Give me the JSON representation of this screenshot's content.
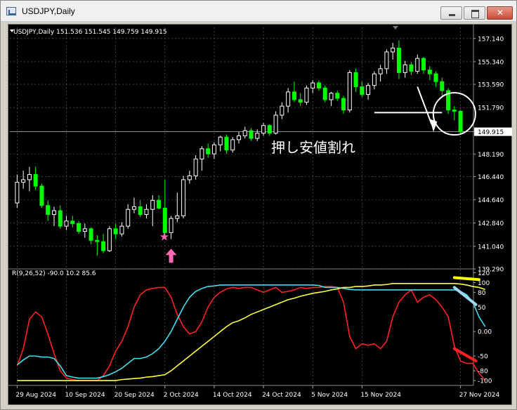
{
  "window": {
    "title": "USDJPY,Daily"
  },
  "chart_data": [
    {
      "type": "candlestick",
      "symbol_line": "USDJPY,Daily  151.536 151.545 149.759 149.915",
      "current_price_label": "149.915",
      "current_price": 149.915,
      "ylim": [
        139.29,
        158.0
      ],
      "price_ticks": [
        "157.140",
        "155.340",
        "153.590",
        "151.790",
        "149.915",
        "148.190",
        "146.440",
        "144.640",
        "142.840",
        "141.040",
        "139.290"
      ],
      "candles": [
        {
          "o": 144.4,
          "h": 146.6,
          "l": 144.0,
          "c": 146.0
        },
        {
          "o": 146.0,
          "h": 146.9,
          "l": 145.5,
          "c": 146.2
        },
        {
          "o": 146.2,
          "h": 147.2,
          "l": 145.3,
          "c": 146.6
        },
        {
          "o": 146.6,
          "h": 147.2,
          "l": 145.4,
          "c": 145.7
        },
        {
          "o": 145.7,
          "h": 145.9,
          "l": 144.0,
          "c": 144.2
        },
        {
          "o": 144.2,
          "h": 144.6,
          "l": 143.0,
          "c": 143.5
        },
        {
          "o": 143.5,
          "h": 144.1,
          "l": 142.6,
          "c": 143.8
        },
        {
          "o": 143.8,
          "h": 144.2,
          "l": 142.4,
          "c": 142.6
        },
        {
          "o": 142.6,
          "h": 143.4,
          "l": 142.3,
          "c": 143.0
        },
        {
          "o": 143.0,
          "h": 143.4,
          "l": 142.5,
          "c": 142.8
        },
        {
          "o": 142.8,
          "h": 143.0,
          "l": 142.0,
          "c": 142.2
        },
        {
          "o": 142.2,
          "h": 142.8,
          "l": 141.7,
          "c": 142.4
        },
        {
          "o": 142.4,
          "h": 142.5,
          "l": 141.2,
          "c": 141.5
        },
        {
          "o": 141.5,
          "h": 141.9,
          "l": 140.3,
          "c": 141.4
        },
        {
          "o": 141.4,
          "h": 142.0,
          "l": 140.5,
          "c": 140.7
        },
        {
          "o": 140.7,
          "h": 142.6,
          "l": 140.6,
          "c": 142.4
        },
        {
          "o": 142.4,
          "h": 142.8,
          "l": 141.6,
          "c": 142.0
        },
        {
          "o": 142.0,
          "h": 142.9,
          "l": 141.8,
          "c": 142.6
        },
        {
          "o": 142.6,
          "h": 144.3,
          "l": 142.4,
          "c": 143.9
        },
        {
          "o": 143.9,
          "h": 144.8,
          "l": 143.6,
          "c": 144.1
        },
        {
          "o": 144.1,
          "h": 144.6,
          "l": 143.3,
          "c": 143.5
        },
        {
          "o": 143.5,
          "h": 144.3,
          "l": 143.2,
          "c": 143.9
        },
        {
          "o": 143.9,
          "h": 145.0,
          "l": 142.6,
          "c": 144.6
        },
        {
          "o": 144.6,
          "h": 145.0,
          "l": 143.9,
          "c": 144.0
        },
        {
          "o": 144.0,
          "h": 146.2,
          "l": 141.8,
          "c": 142.1
        },
        {
          "o": 142.1,
          "h": 143.4,
          "l": 141.6,
          "c": 143.2
        },
        {
          "o": 143.2,
          "h": 145.2,
          "l": 142.9,
          "c": 143.4
        },
        {
          "o": 143.4,
          "h": 146.5,
          "l": 143.2,
          "c": 146.2
        },
        {
          "o": 146.2,
          "h": 146.9,
          "l": 145.9,
          "c": 146.5
        },
        {
          "o": 146.5,
          "h": 148.1,
          "l": 146.2,
          "c": 147.8
        },
        {
          "o": 147.8,
          "h": 148.8,
          "l": 146.9,
          "c": 148.6
        },
        {
          "o": 148.6,
          "h": 149.0,
          "l": 147.9,
          "c": 148.2
        },
        {
          "o": 148.2,
          "h": 149.1,
          "l": 147.8,
          "c": 148.9
        },
        {
          "o": 148.9,
          "h": 149.6,
          "l": 148.4,
          "c": 149.5
        },
        {
          "o": 149.5,
          "h": 149.7,
          "l": 148.2,
          "c": 148.5
        },
        {
          "o": 148.5,
          "h": 149.5,
          "l": 148.3,
          "c": 149.3
        },
        {
          "o": 149.3,
          "h": 149.9,
          "l": 149.0,
          "c": 149.6
        },
        {
          "o": 149.6,
          "h": 150.3,
          "l": 149.4,
          "c": 150.0
        },
        {
          "o": 150.0,
          "h": 150.2,
          "l": 149.2,
          "c": 149.4
        },
        {
          "o": 149.4,
          "h": 150.1,
          "l": 149.2,
          "c": 149.8
        },
        {
          "o": 149.8,
          "h": 150.6,
          "l": 149.6,
          "c": 150.4
        },
        {
          "o": 150.4,
          "h": 150.5,
          "l": 149.6,
          "c": 149.8
        },
        {
          "o": 149.8,
          "h": 151.5,
          "l": 149.7,
          "c": 151.2
        },
        {
          "o": 151.2,
          "h": 152.2,
          "l": 150.9,
          "c": 151.9
        },
        {
          "o": 151.9,
          "h": 153.3,
          "l": 151.4,
          "c": 153.0
        },
        {
          "o": 153.0,
          "h": 153.8,
          "l": 152.2,
          "c": 152.4
        },
        {
          "o": 152.4,
          "h": 152.9,
          "l": 151.9,
          "c": 152.2
        },
        {
          "o": 152.2,
          "h": 153.5,
          "l": 152.0,
          "c": 153.3
        },
        {
          "o": 153.3,
          "h": 153.9,
          "l": 152.9,
          "c": 153.7
        },
        {
          "o": 153.7,
          "h": 153.9,
          "l": 153.1,
          "c": 153.3
        },
        {
          "o": 153.3,
          "h": 153.5,
          "l": 152.2,
          "c": 152.4
        },
        {
          "o": 152.4,
          "h": 153.0,
          "l": 151.9,
          "c": 152.9
        },
        {
          "o": 152.9,
          "h": 153.1,
          "l": 152.3,
          "c": 152.5
        },
        {
          "o": 152.5,
          "h": 152.7,
          "l": 151.3,
          "c": 151.6
        },
        {
          "o": 151.6,
          "h": 154.7,
          "l": 151.4,
          "c": 154.5
        },
        {
          "o": 154.5,
          "h": 154.8,
          "l": 153.0,
          "c": 153.4
        },
        {
          "o": 153.4,
          "h": 153.8,
          "l": 152.6,
          "c": 152.8
        },
        {
          "o": 152.8,
          "h": 153.7,
          "l": 152.4,
          "c": 153.5
        },
        {
          "o": 153.5,
          "h": 154.6,
          "l": 153.2,
          "c": 154.4
        },
        {
          "o": 154.4,
          "h": 155.1,
          "l": 153.8,
          "c": 154.8
        },
        {
          "o": 154.8,
          "h": 156.3,
          "l": 154.4,
          "c": 156.1
        },
        {
          "o": 156.1,
          "h": 156.8,
          "l": 155.5,
          "c": 156.4
        },
        {
          "o": 156.4,
          "h": 157.0,
          "l": 154.0,
          "c": 154.5
        },
        {
          "o": 154.5,
          "h": 155.4,
          "l": 154.1,
          "c": 155.1
        },
        {
          "o": 155.1,
          "h": 155.3,
          "l": 154.3,
          "c": 154.6
        },
        {
          "o": 154.6,
          "h": 155.9,
          "l": 154.4,
          "c": 155.6
        },
        {
          "o": 155.6,
          "h": 155.7,
          "l": 154.4,
          "c": 154.7
        },
        {
          "o": 154.7,
          "h": 155.0,
          "l": 153.9,
          "c": 154.4
        },
        {
          "o": 154.4,
          "h": 154.6,
          "l": 153.4,
          "c": 153.8
        },
        {
          "o": 153.8,
          "h": 154.1,
          "l": 152.7,
          "c": 153.1
        },
        {
          "o": 153.1,
          "h": 153.3,
          "l": 151.3,
          "c": 151.6
        },
        {
          "o": 151.6,
          "h": 151.9,
          "l": 150.8,
          "c": 151.5
        },
        {
          "o": 151.5,
          "h": 151.6,
          "l": 149.8,
          "c": 149.9
        }
      ],
      "date_labels": [
        "29 Aug 2024",
        "10 Sep 2024",
        "20 Sep 2024",
        "2 Oct 2024",
        "14 Oct 2024",
        "24 Oct 2024",
        "5 Nov 2024",
        "15 Nov 2024",
        "27 Nov 2024"
      ],
      "annotations": {
        "support_break_text": "押し安値割れ",
        "star_symbol": "★",
        "support_level": 151.4,
        "colors": {
          "bull": "#ffffff",
          "bear": "#00ff00",
          "star": "#ff69b4",
          "arrow": "#ff69b4",
          "line": "#ffffff"
        }
      }
    },
    {
      "type": "line",
      "indicator_label": "R(9,26,52) -90.0 10.2 85.6",
      "ylim": [
        -110,
        125
      ],
      "y_ticks": [
        "120",
        "100",
        "80",
        "50",
        "0.00",
        "-50",
        "-80",
        "-100"
      ],
      "series": [
        {
          "color": "#ff2020",
          "values": [
            -70,
            -35,
            25,
            40,
            30,
            -5,
            -45,
            -80,
            -95,
            -98,
            -100,
            -100,
            -100,
            -100,
            -90,
            -70,
            -40,
            -20,
            10,
            50,
            75,
            85,
            88,
            90,
            90,
            70,
            35,
            10,
            -5,
            0,
            20,
            50,
            70,
            80,
            87,
            90,
            88,
            90,
            90,
            85,
            80,
            85,
            90,
            80,
            82,
            85,
            90,
            88,
            90,
            90,
            92,
            92,
            90,
            60,
            -10,
            -35,
            -25,
            -28,
            -25,
            -35,
            -20,
            30,
            60,
            75,
            85,
            60,
            70,
            75,
            65,
            50,
            30,
            -30,
            -60,
            -65,
            -65,
            -85,
            -100
          ]
        },
        {
          "color": "#40e0f0",
          "values": [
            -68,
            -58,
            -50,
            -50,
            -52,
            -52,
            -55,
            -70,
            -90,
            -93,
            -95,
            -95,
            -95,
            -95,
            -92,
            -88,
            -82,
            -75,
            -65,
            -55,
            -55,
            -52,
            -45,
            -35,
            -20,
            0,
            25,
            50,
            70,
            82,
            88,
            92,
            93,
            95,
            95,
            95,
            95,
            95,
            95,
            95,
            95,
            95,
            95,
            95,
            95,
            95,
            95,
            95,
            95,
            94,
            90,
            90,
            90,
            88,
            86,
            85,
            85,
            85,
            85,
            85,
            85,
            85,
            85,
            85,
            85,
            85,
            85,
            85,
            85,
            85,
            85,
            85,
            82,
            75,
            60,
            30,
            10
          ]
        },
        {
          "color": "#ffff40",
          "values": [
            -100,
            -100,
            -100,
            -100,
            -100,
            -100,
            -100,
            -100,
            -100,
            -100,
            -100,
            -100,
            -100,
            -100,
            -100,
            -100,
            -100,
            -98,
            -97,
            -96,
            -95,
            -93,
            -92,
            -90,
            -88,
            -80,
            -70,
            -60,
            -50,
            -40,
            -30,
            -20,
            -10,
            0,
            10,
            18,
            22,
            28,
            35,
            40,
            45,
            50,
            55,
            60,
            65,
            68,
            72,
            75,
            78,
            80,
            82,
            85,
            87,
            90,
            90,
            92,
            92,
            93,
            95,
            95,
            96,
            98,
            98,
            98,
            98,
            98,
            98,
            98,
            98,
            98,
            98,
            98,
            97,
            95,
            92,
            90,
            86
          ]
        }
      ]
    }
  ]
}
